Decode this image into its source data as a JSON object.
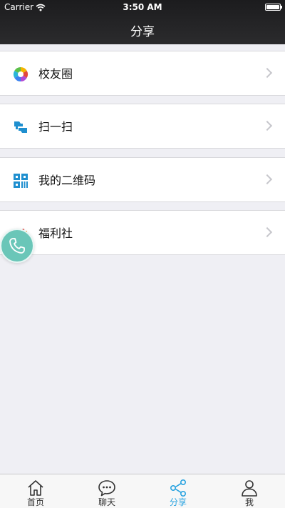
{
  "status": {
    "carrier": "Carrier",
    "time": "3:50 AM"
  },
  "nav": {
    "title": "分享"
  },
  "list": {
    "items": [
      {
        "label": "校友圈",
        "icon": "camera-aperture-icon"
      },
      {
        "label": "扫一扫",
        "icon": "scan-icon"
      },
      {
        "label": "我的二维码",
        "icon": "qr-code-icon"
      },
      {
        "label": "福利社",
        "icon": "gift-icon"
      }
    ]
  },
  "floating": {
    "icon": "phone-icon",
    "color": "#6ac6b8"
  },
  "tabbar": {
    "active_color": "#29a3e0",
    "tabs": [
      {
        "label": "首页",
        "icon": "home-icon"
      },
      {
        "label": "聊天",
        "icon": "chat-bubble-icon"
      },
      {
        "label": "分享",
        "icon": "share-icon",
        "active": true
      },
      {
        "label": "我",
        "icon": "person-icon"
      }
    ]
  }
}
